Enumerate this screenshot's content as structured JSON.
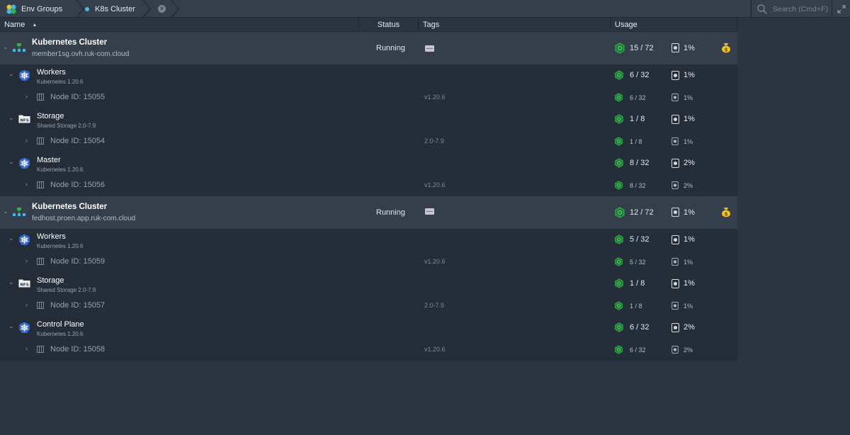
{
  "breadcrumbs": {
    "env_groups": "Env Groups",
    "cluster": "K8s Cluster",
    "close": "×"
  },
  "search": {
    "placeholder": "Search (Cmd+F)"
  },
  "columns": {
    "name": "Name",
    "status": "Status",
    "tags": "Tags",
    "usage": "Usage"
  },
  "colors": {
    "accent": "#2fb34a",
    "background": "#2b3441",
    "row_env": "#353e4b",
    "row_child": "#252d38",
    "billing": "#f2c318"
  },
  "environments": [
    {
      "name": "Kubernetes Cluster",
      "domain": "member1sg.ovh.ruk-com.cloud",
      "status": "Running",
      "cloudlets": "15 / 72",
      "disk": "1%",
      "groups": [
        {
          "name": "Workers",
          "sub": "Kubernetes 1.20.6",
          "icon": "kubernetes-icon",
          "cloudlets": "6 / 32",
          "disk": "1%",
          "node": {
            "label": "Node ID: 15055",
            "version": "v1.20.6",
            "cloudlets": "6 / 32",
            "disk": "1%"
          }
        },
        {
          "name": "Storage",
          "sub": "Shared Storage 2.0-7.9",
          "icon": "nfs-storage-icon",
          "cloudlets": "1 / 8",
          "disk": "1%",
          "node": {
            "label": "Node ID: 15054",
            "version": "2.0-7.9",
            "cloudlets": "1 / 8",
            "disk": "1%"
          }
        },
        {
          "name": "Master",
          "sub": "Kubernetes 1.20.6",
          "icon": "kubernetes-icon",
          "cloudlets": "8 / 32",
          "disk": "2%",
          "node": {
            "label": "Node ID: 15056",
            "version": "v1.20.6",
            "cloudlets": "8 / 32",
            "disk": "2%"
          }
        }
      ]
    },
    {
      "name": "Kubernetes Cluster",
      "domain": "fedhost.proen.app.ruk-com.cloud",
      "status": "Running",
      "cloudlets": "12 / 72",
      "disk": "1%",
      "groups": [
        {
          "name": "Workers",
          "sub": "Kubernetes 1.20.6",
          "icon": "kubernetes-icon",
          "cloudlets": "5 / 32",
          "disk": "1%",
          "node": {
            "label": "Node ID: 15059",
            "version": "v1.20.6",
            "cloudlets": "5 / 32",
            "disk": "1%"
          }
        },
        {
          "name": "Storage",
          "sub": "Shared Storage 2.0-7.9",
          "icon": "nfs-storage-icon",
          "cloudlets": "1 / 8",
          "disk": "1%",
          "node": {
            "label": "Node ID: 15057",
            "version": "2.0-7.9",
            "cloudlets": "1 / 8",
            "disk": "1%"
          }
        },
        {
          "name": "Control Plane",
          "sub": "Kubernetes 1.20.6",
          "icon": "kubernetes-icon",
          "cloudlets": "6 / 32",
          "disk": "2%",
          "node": {
            "label": "Node ID: 15058",
            "version": "v1.20.6",
            "cloudlets": "6 / 32",
            "disk": "2%"
          }
        }
      ]
    }
  ]
}
